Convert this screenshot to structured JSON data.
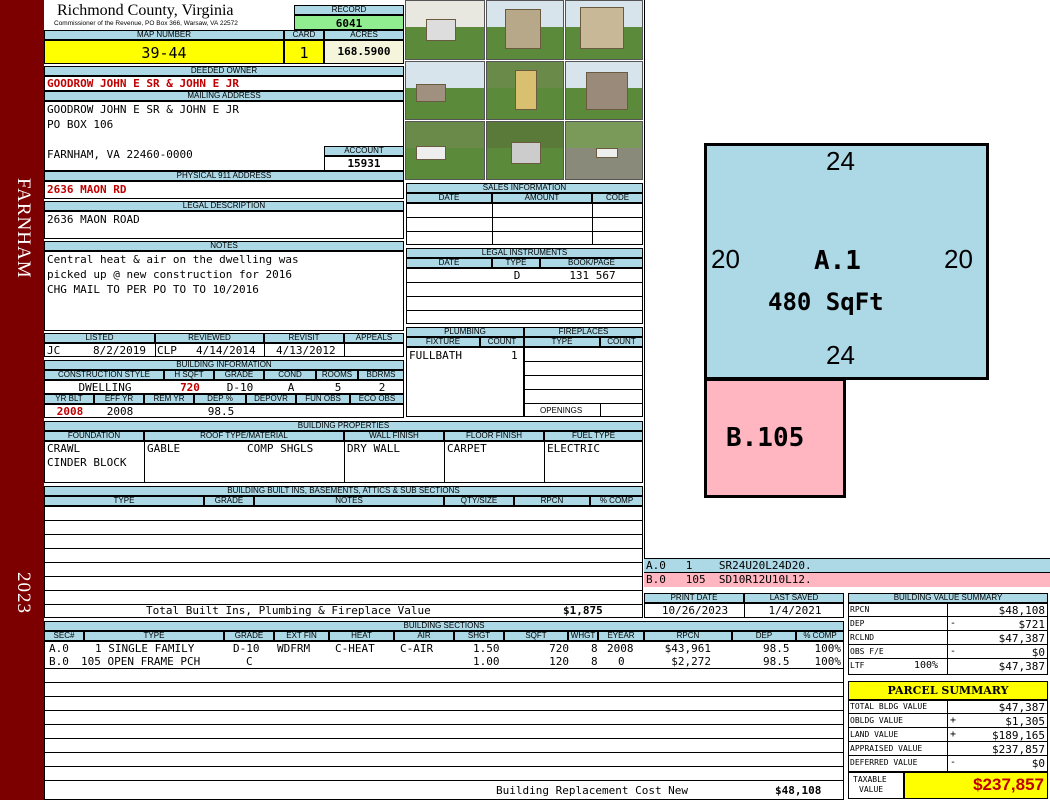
{
  "side": {
    "top": "FARNHAM",
    "bottom": "2023"
  },
  "header": {
    "county": "Richmond County, Virginia",
    "address": "Commissioner of the Revenue, PO Box 366, Warsaw, VA 22572"
  },
  "record": {
    "label": "RECORD",
    "value": "6041"
  },
  "map": {
    "label": "MAP NUMBER",
    "value": "39-44",
    "card_label": "CARD",
    "card": "1",
    "acres_label": "ACRES",
    "acres": "168.5900"
  },
  "owner": {
    "label": "DEEDED OWNER",
    "value": "GOODROW JOHN E SR & JOHN E JR"
  },
  "mailing": {
    "label": "MAILING ADDRESS",
    "line1": "GOODROW JOHN E SR & JOHN E JR",
    "line2": "PO BOX 106",
    "line3": "FARNHAM, VA 22460-0000"
  },
  "account": {
    "label": "ACCOUNT",
    "value": "15931"
  },
  "physical": {
    "label": "PHYSICAL 911 ADDRESS",
    "value": "2636 MAON RD"
  },
  "legal": {
    "label": "LEGAL DESCRIPTION",
    "value": "2636 MAON ROAD"
  },
  "notes": {
    "label": "NOTES",
    "lines": [
      "Central heat & air on the dwelling was",
      "picked up @ new construction for 2016",
      "CHG MAIL TO PER PO TO TO 10/2016"
    ]
  },
  "dates": {
    "listed_label": "LISTED",
    "listed_by": "JC",
    "listed": "8/2/2019",
    "reviewed_label": "REVIEWED",
    "reviewed_by": "CLP",
    "reviewed": "4/14/2014",
    "revisit_label": "REVISIT",
    "revisit": "4/13/2012",
    "appeals_label": "APPEALS"
  },
  "building_info": {
    "label": "BUILDING INFORMATION",
    "headers": [
      "CONSTRUCTION STYLE",
      "H SQFT",
      "GRADE",
      "COND",
      "ROOMS",
      "BDRMS"
    ],
    "values": [
      "DWELLING",
      "720",
      "D-10",
      "A",
      "5",
      "2"
    ],
    "headers2": [
      "YR BLT",
      "EFF YR",
      "REM YR",
      "DEP %",
      "DEPOVR",
      "FUN OBS",
      "ECO OBS"
    ],
    "values2": [
      "2008",
      "2008",
      "",
      "98.5",
      "",
      "",
      ""
    ]
  },
  "sales": {
    "label": "SALES INFORMATION",
    "headers": [
      "DATE",
      "AMOUNT",
      "CODE"
    ]
  },
  "legal_instr": {
    "label": "LEGAL INSTRUMENTS",
    "headers": [
      "DATE",
      "TYPE",
      "BOOK/PAGE"
    ],
    "row": [
      "",
      "D",
      "131 567"
    ]
  },
  "plumbing": {
    "label": "PLUMBING",
    "headers": [
      "FIXTURE",
      "COUNT"
    ],
    "row": [
      "FULLBATH",
      "1"
    ]
  },
  "fireplaces": {
    "label": "FIREPLACES",
    "headers": [
      "TYPE",
      "COUNT"
    ],
    "openings": "OPENINGS"
  },
  "props": {
    "label": "BUILDING PROPERTIES",
    "headers": [
      "FOUNDATION",
      "ROOF TYPE/MATERIAL",
      "WALL FINISH",
      "FLOOR FINISH",
      "FUEL TYPE"
    ],
    "foundation1": "CRAWL",
    "foundation2": "CINDER BLOCK",
    "roof1": "GABLE",
    "roof2": "COMP SHGLS",
    "wall": "DRY WALL",
    "floor": "CARPET",
    "fuel": "ELECTRIC"
  },
  "builtins": {
    "label": "BUILDING BUILT INS, BASEMENTS, ATTICS & SUB SECTIONS",
    "headers": [
      "TYPE",
      "GRADE",
      "NOTES",
      "QTY/SIZE",
      "RPCN",
      "% COMP"
    ],
    "total_label": "Total Built Ins, Plumbing & Fireplace Value",
    "total": "$1,875"
  },
  "sections": {
    "label": "BUILDING SECTIONS",
    "headers": [
      "SEC#",
      "TYPE",
      "GRADE",
      "EXT FIN",
      "HEAT",
      "AIR",
      "SHGT",
      "SQFT",
      "WHGT",
      "EYEAR",
      "RPCN",
      "DEP",
      "% COMP"
    ],
    "rows": [
      [
        "A.0",
        "1 SINGLE FAMILY",
        "D-10",
        "WDFRM",
        "C-HEAT",
        "C-AIR",
        "1.50",
        "720",
        "8",
        "2008",
        "$43,961",
        "98.5",
        "100%"
      ],
      [
        "B.0",
        "105 OPEN FRAME PCH",
        "C",
        "",
        "",
        "",
        "1.00",
        "120",
        "8",
        "0",
        "$2,272",
        "98.5",
        "100%"
      ]
    ],
    "replacement_label": "Building Replacement Cost New",
    "replacement": "$48,108"
  },
  "sketch": {
    "top": "24",
    "bottom": "24",
    "left": "20",
    "right": "20",
    "a_label": "A.1",
    "a_area": "480 SqFt",
    "b_label": "B.105",
    "line_a": "A.0   1    SR24U20L24D20.",
    "line_b": "B.0   105  SD10R12U10L12.",
    "color_a": "#add8e6",
    "color_b": "#ffb6c1"
  },
  "print": {
    "print_label": "PRINT DATE",
    "print": "10/26/2023",
    "saved_label": "LAST SAVED",
    "saved": "1/4/2021"
  },
  "bvs": {
    "label": "BUILDING VALUE SUMMARY",
    "rows": [
      {
        "k": "RPCN",
        "s": "",
        "v": "$48,108"
      },
      {
        "k": "DEP",
        "s": "-",
        "v": "$721"
      },
      {
        "k": "RCLND",
        "s": "",
        "v": "$47,387"
      },
      {
        "k": "OBS F/E",
        "s": "-",
        "v": "$0"
      },
      {
        "k": "LTF",
        "s": "100%",
        "v": "$47,387"
      }
    ]
  },
  "parcel": {
    "label": "PARCEL SUMMARY",
    "rows": [
      {
        "k": "TOTAL BLDG VALUE",
        "s": "",
        "v": "$47,387"
      },
      {
        "k": "OBLDG VALUE",
        "s": "+",
        "v": "$1,305"
      },
      {
        "k": "LAND VALUE",
        "s": "+",
        "v": "$189,165"
      },
      {
        "k": "APPRAISED VALUE",
        "s": "",
        "v": "$237,857"
      },
      {
        "k": "DEFERRED VALUE",
        "s": "-",
        "v": "$0"
      }
    ],
    "taxable_label1": "TAXABLE",
    "taxable_label2": "VALUE",
    "taxable": "$237,857"
  }
}
